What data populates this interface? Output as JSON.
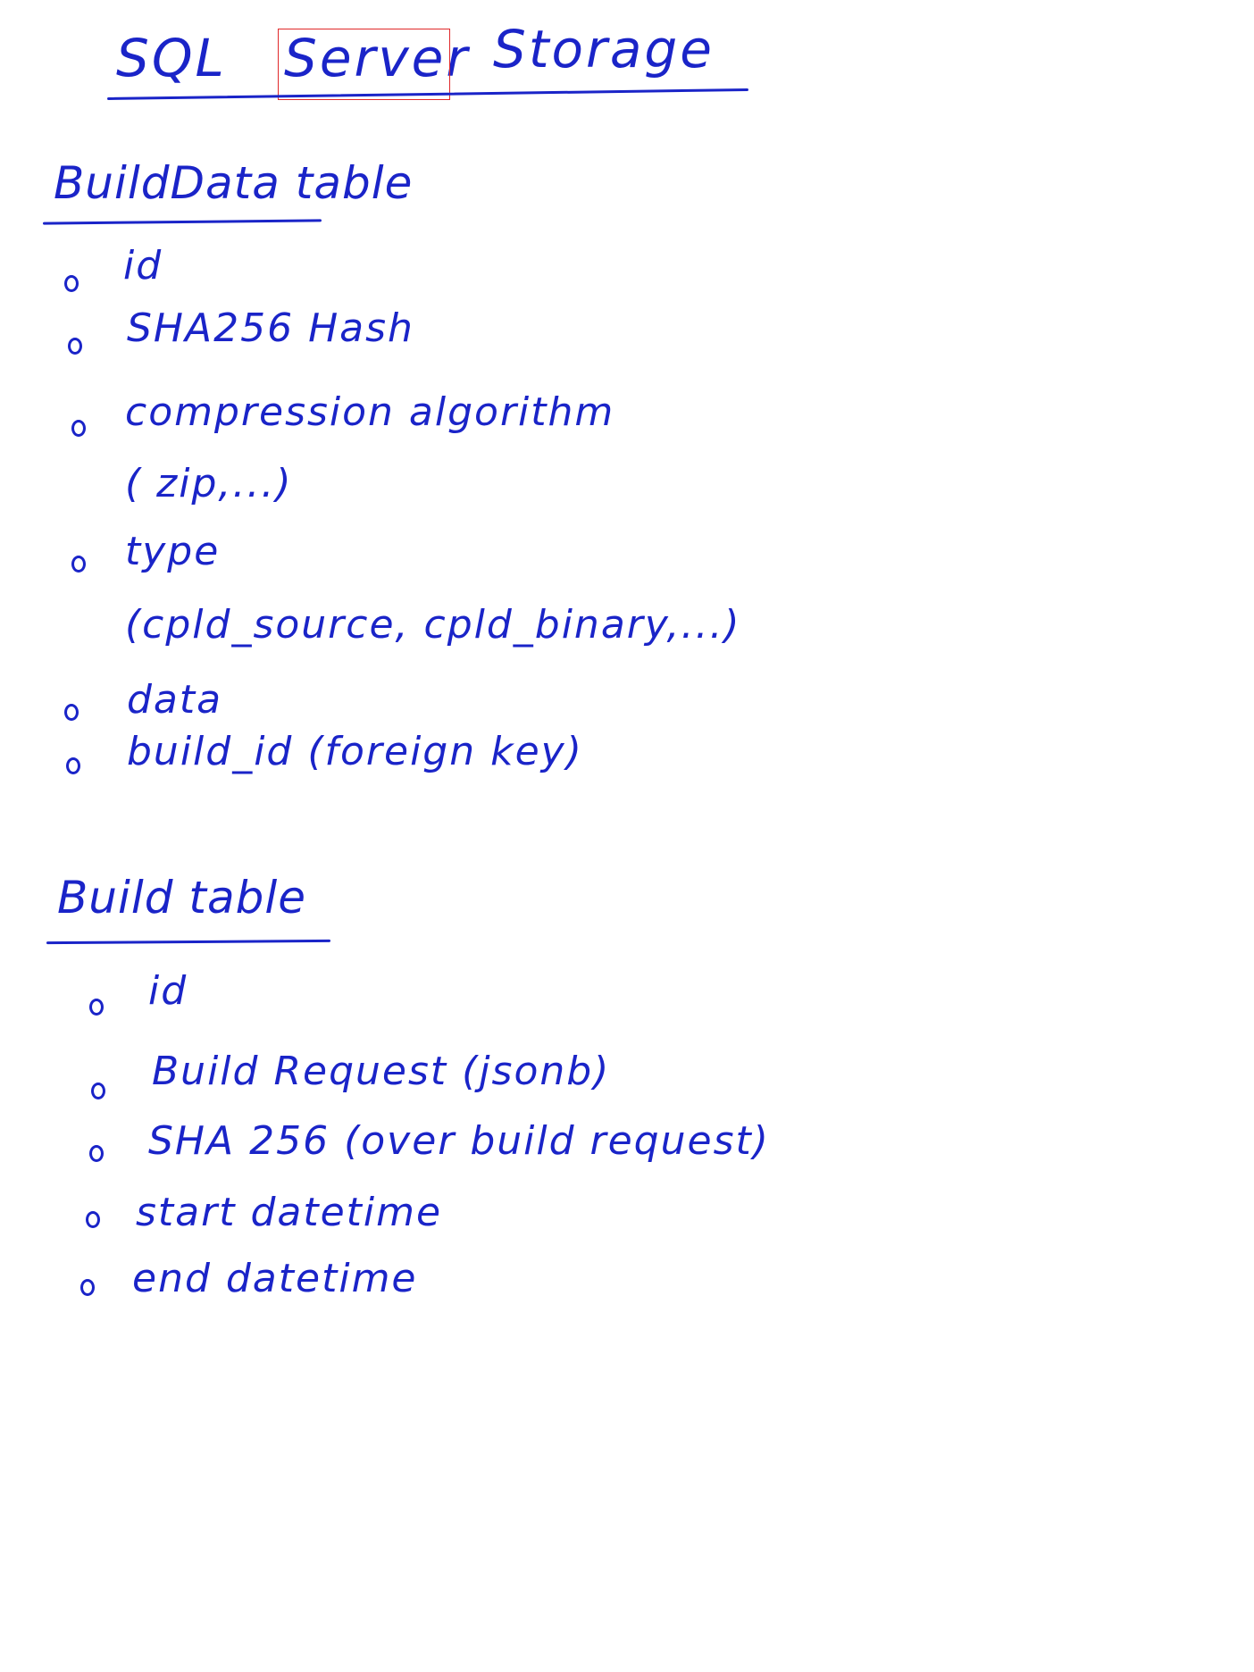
{
  "title": {
    "part1": "SQL",
    "part2": "Server",
    "part3": "Storage"
  },
  "build_data_table": {
    "heading": "BuildData table",
    "items": [
      {
        "text": "id"
      },
      {
        "text": "SHA256 Hash"
      },
      {
        "text": "compression algorithm",
        "sub": "( zip,...)"
      },
      {
        "text": "type",
        "sub": "(cpld_source, cpld_binary,...)"
      },
      {
        "text": "data"
      },
      {
        "text": "build_id (foreign key)"
      }
    ]
  },
  "build_table": {
    "heading": "Build table",
    "items": [
      {
        "text": "id"
      },
      {
        "text": "Build Request (jsonb)"
      },
      {
        "text": "SHA 256 (over build request)"
      },
      {
        "text": "start datetime"
      },
      {
        "text": "end datetime"
      }
    ]
  },
  "colors": {
    "ink": "#1a24c8",
    "highlight": "#e0282a"
  }
}
